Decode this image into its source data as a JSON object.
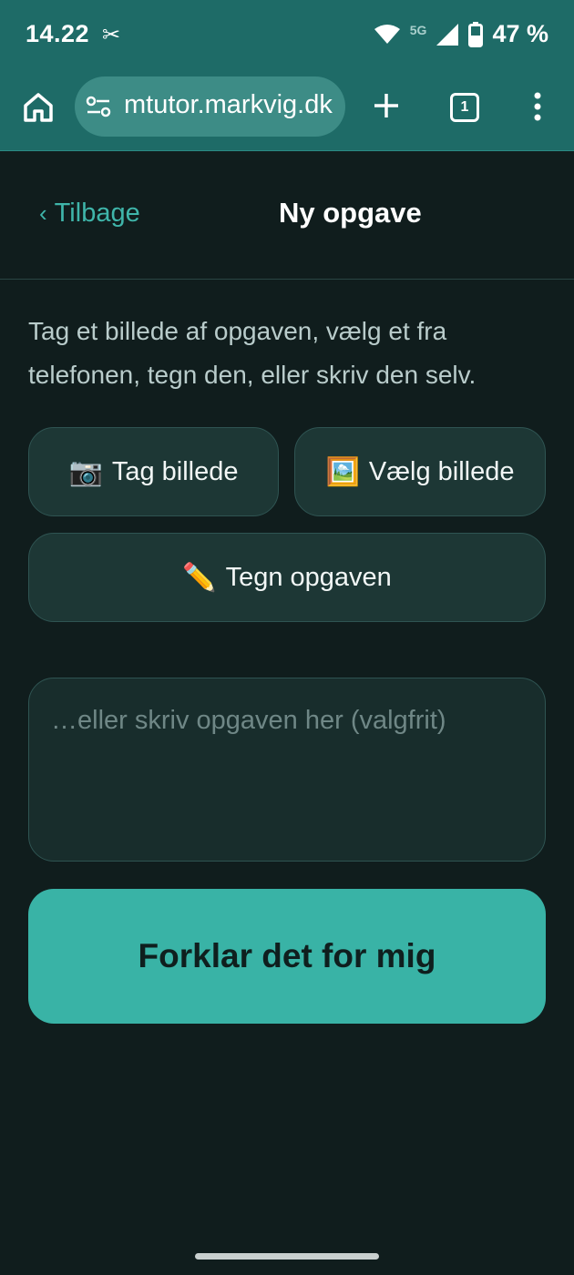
{
  "status_bar": {
    "time": "14.22",
    "extra_icon": "✂",
    "network": "5G",
    "battery": "47 %",
    "icons": [
      "wifi-icon",
      "signal-icon",
      "battery-icon"
    ]
  },
  "browser": {
    "url": "mtutor.markvig.dk",
    "tab_count": "1",
    "icons": [
      "home-icon",
      "site-settings-icon",
      "plus-icon",
      "tabs-icon",
      "menu-dots-icon"
    ]
  },
  "header": {
    "back_chevron": "‹",
    "back_label": "Tilbage",
    "title": "Ny opgave"
  },
  "content": {
    "intro": "Tag et billede af opgaven, vælg et fra telefonen, tegn den, eller skriv den selv.",
    "buttons": {
      "photo": {
        "emoji": "📷",
        "label": "Tag billede"
      },
      "choose": {
        "emoji": "🖼️",
        "label": "Vælg billede"
      },
      "draw": {
        "emoji": "✏️",
        "label": "Tegn opgaven"
      }
    },
    "input": {
      "placeholder": "…eller skriv opgaven her (valgfrit)",
      "value": ""
    },
    "submit_label": "Forklar det for mig"
  },
  "colors": {
    "accent": "#39b3a6",
    "topbar": "#1e6b67",
    "background": "#101d1d"
  }
}
